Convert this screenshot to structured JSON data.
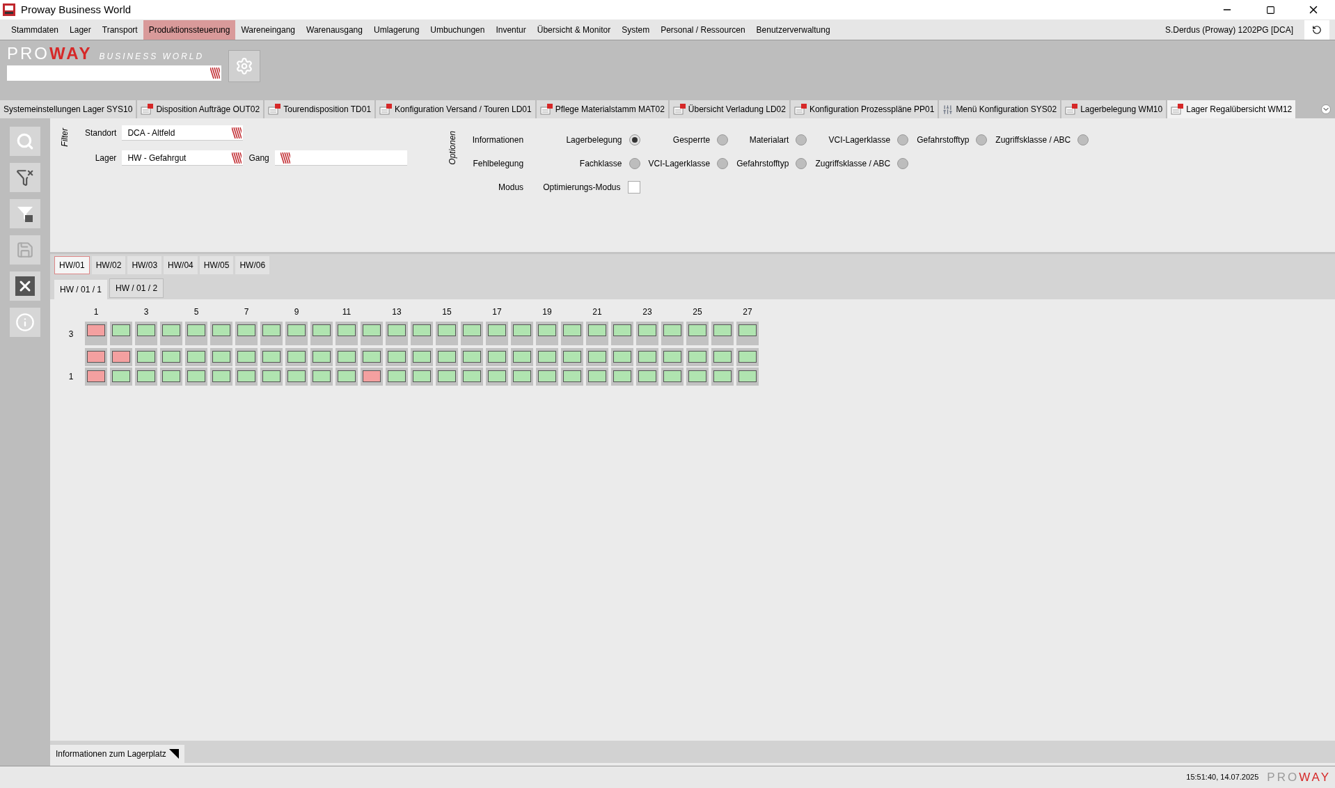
{
  "window": {
    "title": "Proway Business World"
  },
  "menu": [
    {
      "label": "Stammdaten",
      "selected": false
    },
    {
      "label": "Lager",
      "selected": false
    },
    {
      "label": "Transport",
      "selected": false
    },
    {
      "label": "Produktionssteuerung",
      "selected": true
    },
    {
      "label": "Wareneingang",
      "selected": false
    },
    {
      "label": "Warenausgang",
      "selected": false
    },
    {
      "label": "Umlagerung",
      "selected": false
    },
    {
      "label": "Umbuchungen",
      "selected": false
    },
    {
      "label": "Inventur",
      "selected": false
    },
    {
      "label": "Übersicht & Monitor",
      "selected": false
    },
    {
      "label": "System",
      "selected": false
    },
    {
      "label": "Personal / Ressourcen",
      "selected": false
    },
    {
      "label": "Benutzerverwaltung",
      "selected": false
    }
  ],
  "user": "S.Derdus (Proway) 1202PG [DCA]",
  "logo": {
    "pro": "PRO",
    "way": "WAY",
    "subtitle": "BUSINESS WORLD"
  },
  "tabs": [
    {
      "label": "Systemeinstellungen Lager SYS10",
      "kind": "plain",
      "selected": false
    },
    {
      "label": "Disposition Aufträge OUT02",
      "kind": "form",
      "selected": false
    },
    {
      "label": "Tourendisposition TD01",
      "kind": "form",
      "selected": false
    },
    {
      "label": "Konfiguration Versand / Touren LD01",
      "kind": "form",
      "selected": false
    },
    {
      "label": "Pflege Materialstamm MAT02",
      "kind": "form",
      "selected": false
    },
    {
      "label": "Übersicht Verladung LD02",
      "kind": "form",
      "selected": false
    },
    {
      "label": "Konfiguration Prozesspläne PP01",
      "kind": "form",
      "selected": false
    },
    {
      "label": "Menü Konfiguration SYS02",
      "kind": "sliders",
      "selected": false
    },
    {
      "label": "Lagerbelegung WM10",
      "kind": "form",
      "selected": false
    },
    {
      "label": "Lager Regalübersicht WM12",
      "kind": "form",
      "selected": true
    }
  ],
  "filter": {
    "title": "Filter",
    "fields": [
      {
        "label": "Standort",
        "value": "DCA - Altfeld"
      },
      {
        "label": "Lager",
        "value": "HW - Gefahrgut"
      },
      {
        "label": "Gang"
      }
    ]
  },
  "options": {
    "title": "Optionen",
    "rows": [
      {
        "label": "Informationen",
        "kind": "radio",
        "items": [
          {
            "label": "Lagerbelegung",
            "selected": true
          },
          {
            "label": "Gesperrte",
            "selected": false
          },
          {
            "label": "Materialart",
            "selected": false
          },
          {
            "label": "VCI-Lagerklasse",
            "selected": false
          },
          {
            "label": "Gefahrstofftyp",
            "selected": false
          },
          {
            "label": "Zugriffsklasse / ABC",
            "selected": false
          }
        ]
      },
      {
        "label": "Fehlbelegung",
        "kind": "radio",
        "items": [
          {
            "label": "Fachklasse",
            "selected": false
          },
          {
            "label": "VCI-Lagerklasse",
            "selected": false
          },
          {
            "label": "Gefahrstofftyp",
            "selected": false
          },
          {
            "label": "Zugriffsklasse / ABC",
            "selected": false
          }
        ]
      },
      {
        "label": "Modus",
        "kind": "checkbox",
        "items": [
          {
            "label": "Optimierungs-Modus",
            "checked": false
          }
        ]
      }
    ]
  },
  "aisle_tabs": [
    {
      "label": "HW/01",
      "selected": true
    },
    {
      "label": "HW/02",
      "selected": false
    },
    {
      "label": "HW/03",
      "selected": false
    },
    {
      "label": "HW/04",
      "selected": false
    },
    {
      "label": "HW/05",
      "selected": false
    },
    {
      "label": "HW/06",
      "selected": false
    }
  ],
  "rack_tabs": [
    {
      "label": "HW / 01 / 1",
      "selected": true
    },
    {
      "label": "HW / 01 / 2",
      "selected": false
    }
  ],
  "grid": {
    "column_labels": [
      "1",
      "3",
      "5",
      "7",
      "9",
      "11",
      "13",
      "15",
      "17",
      "19",
      "21",
      "23",
      "25",
      "27"
    ],
    "rows": [
      {
        "label": "3",
        "cells": [
          true,
          false,
          false,
          false,
          false,
          false,
          false,
          false,
          false,
          false,
          false,
          false,
          false,
          false,
          false,
          false,
          false,
          false,
          false,
          false,
          false,
          false,
          false,
          false,
          false,
          false,
          false
        ]
      },
      {
        "cells": [
          true,
          true,
          false,
          false,
          false,
          false,
          false,
          false,
          false,
          false,
          false,
          false,
          false,
          false,
          false,
          false,
          false,
          false,
          false,
          false,
          false,
          false,
          false,
          false,
          false,
          false,
          false
        ]
      },
      {
        "label": "1",
        "cells": [
          true,
          false,
          false,
          false,
          false,
          false,
          false,
          false,
          false,
          false,
          false,
          true,
          false,
          false,
          false,
          false,
          false,
          false,
          false,
          false,
          false,
          false,
          false,
          false,
          false,
          false,
          false
        ]
      }
    ]
  },
  "info_tab": "Informationen zum Lagerplatz",
  "status_bar": {
    "time": "15:51:40, 14.07.2025",
    "logo_pro": "PRO",
    "logo_way": "WAY"
  }
}
